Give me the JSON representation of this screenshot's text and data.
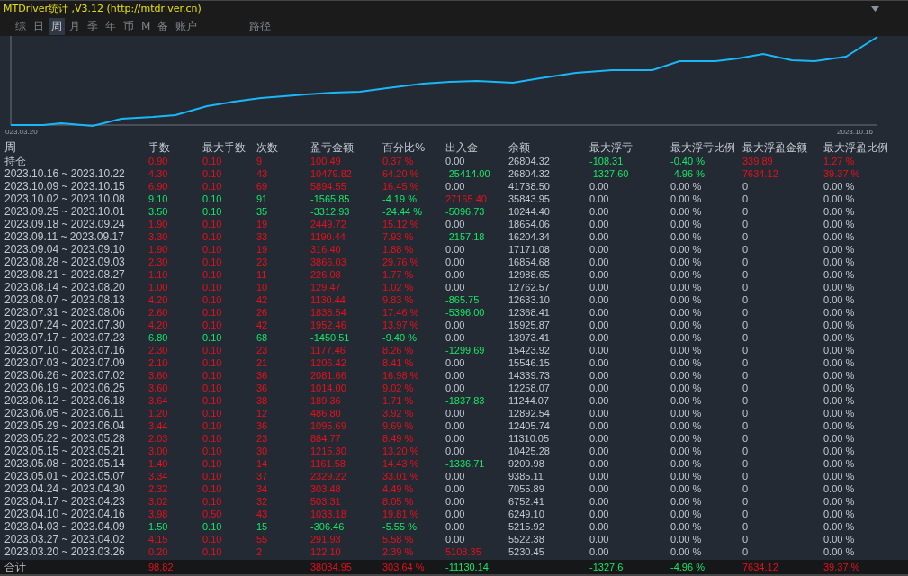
{
  "window": {
    "title": "MTDriver统计 ,V3.12 (http://mtdriver.cn)"
  },
  "tabs": [
    {
      "label": "综",
      "selected": false
    },
    {
      "label": "日",
      "selected": false
    },
    {
      "label": "周",
      "selected": true
    },
    {
      "label": "月",
      "selected": false
    },
    {
      "label": "季",
      "selected": false
    },
    {
      "label": "年",
      "selected": false
    },
    {
      "label": "币",
      "selected": false
    },
    {
      "label": "M",
      "selected": false
    },
    {
      "label": "备",
      "selected": false
    },
    {
      "label": "账户",
      "selected": false
    },
    {
      "label": "路径",
      "selected": false
    }
  ],
  "chart": {
    "start_label": "023.03.20",
    "end_label": "2023.10.16"
  },
  "table": {
    "columns": [
      "周",
      "手数",
      "最大手数",
      "次数",
      "盈亏金额",
      "百分比%",
      "出入金",
      "余额",
      "最大浮亏",
      "最大浮亏比例",
      "最大浮盈金额",
      "最大浮盈比例"
    ],
    "rows": [
      {
        "cells": [
          "持仓",
          "0.90",
          "0.10",
          "9",
          "100.49",
          "0.37 %",
          "0.00",
          "26804.32",
          "-108.31",
          "-0.40 %",
          "339.89",
          "1.27 %"
        ],
        "loss": false,
        "withdrawn": false,
        "deposited": false,
        "floating": true
      },
      {
        "cells": [
          "2023.10.16 ~ 2023.10.22",
          "4.30",
          "0.10",
          "43",
          "10479.82",
          "64.20 %",
          "-25414.00",
          "26804.32",
          "-1327.60",
          "-4.96 %",
          "7634.12",
          "39.37 %"
        ],
        "loss": false,
        "withdrawn": true,
        "deposited": false,
        "floating": true
      },
      {
        "cells": [
          "2023.10.09 ~ 2023.10.15",
          "6.90",
          "0.10",
          "69",
          "5894.55",
          "16.45 %",
          "0.00",
          "41738.50",
          "0.00",
          "0.00 %",
          "0",
          "0.00 %"
        ],
        "loss": false,
        "withdrawn": false,
        "deposited": false,
        "floating": false
      },
      {
        "cells": [
          "2023.10.02 ~ 2023.10.08",
          "9.10",
          "0.10",
          "91",
          "-1565.85",
          "-4.19 %",
          "27165.40",
          "35843.95",
          "0.00",
          "0.00 %",
          "0",
          "0.00 %"
        ],
        "loss": true,
        "withdrawn": false,
        "deposited": true,
        "floating": false
      },
      {
        "cells": [
          "2023.09.25 ~ 2023.10.01",
          "3.50",
          "0.10",
          "35",
          "-3312.93",
          "-24.44 %",
          "-5096.73",
          "10244.40",
          "0.00",
          "0.00 %",
          "0",
          "0.00 %"
        ],
        "loss": true,
        "withdrawn": true,
        "deposited": false,
        "floating": false
      },
      {
        "cells": [
          "2023.09.18 ~ 2023.09.24",
          "1.90",
          "0.10",
          "19",
          "2449.72",
          "15.12 %",
          "0.00",
          "18654.06",
          "0.00",
          "0.00 %",
          "0",
          "0.00 %"
        ],
        "loss": false,
        "withdrawn": false,
        "deposited": false,
        "floating": false
      },
      {
        "cells": [
          "2023.09.11 ~ 2023.09.17",
          "3.30",
          "0.10",
          "33",
          "1190.44",
          "7.93 %",
          "-2157.18",
          "16204.34",
          "0.00",
          "0.00 %",
          "0",
          "0.00 %"
        ],
        "loss": false,
        "withdrawn": true,
        "deposited": false,
        "floating": false
      },
      {
        "cells": [
          "2023.09.04 ~ 2023.09.10",
          "1.90",
          "0.10",
          "19",
          "316.40",
          "1.88 %",
          "0.00",
          "17171.08",
          "0.00",
          "0.00 %",
          "0",
          "0.00 %"
        ],
        "loss": false,
        "withdrawn": false,
        "deposited": false,
        "floating": false
      },
      {
        "cells": [
          "2023.08.28 ~ 2023.09.03",
          "2.30",
          "0.10",
          "23",
          "3866.03",
          "29.76 %",
          "0.00",
          "16854.68",
          "0.00",
          "0.00 %",
          "0",
          "0.00 %"
        ],
        "loss": false,
        "withdrawn": false,
        "deposited": false,
        "floating": false
      },
      {
        "cells": [
          "2023.08.21 ~ 2023.08.27",
          "1.10",
          "0.10",
          "11",
          "226.08",
          "1.77 %",
          "0.00",
          "12988.65",
          "0.00",
          "0.00 %",
          "0",
          "0.00 %"
        ],
        "loss": false,
        "withdrawn": false,
        "deposited": false,
        "floating": false
      },
      {
        "cells": [
          "2023.08.14 ~ 2023.08.20",
          "1.00",
          "0.10",
          "10",
          "129.47",
          "1.02 %",
          "0.00",
          "12762.57",
          "0.00",
          "0.00 %",
          "0",
          "0.00 %"
        ],
        "loss": false,
        "withdrawn": false,
        "deposited": false,
        "floating": false
      },
      {
        "cells": [
          "2023.08.07 ~ 2023.08.13",
          "4.20",
          "0.10",
          "42",
          "1130.44",
          "9.83 %",
          "-865.75",
          "12633.10",
          "0.00",
          "0.00 %",
          "0",
          "0.00 %"
        ],
        "loss": false,
        "withdrawn": true,
        "deposited": false,
        "floating": false
      },
      {
        "cells": [
          "2023.07.31 ~ 2023.08.06",
          "2.60",
          "0.10",
          "26",
          "1838.54",
          "17.46 %",
          "-5396.00",
          "12368.41",
          "0.00",
          "0.00 %",
          "0",
          "0.00 %"
        ],
        "loss": false,
        "withdrawn": true,
        "deposited": false,
        "floating": false
      },
      {
        "cells": [
          "2023.07.24 ~ 2023.07.30",
          "4.20",
          "0.10",
          "42",
          "1952.46",
          "13.97 %",
          "0.00",
          "15925.87",
          "0.00",
          "0.00 %",
          "0",
          "0.00 %"
        ],
        "loss": false,
        "withdrawn": false,
        "deposited": false,
        "floating": false
      },
      {
        "cells": [
          "2023.07.17 ~ 2023.07.23",
          "6.80",
          "0.10",
          "68",
          "-1450.51",
          "-9.40 %",
          "0.00",
          "13973.41",
          "0.00",
          "0.00 %",
          "0",
          "0.00 %"
        ],
        "loss": true,
        "withdrawn": false,
        "deposited": false,
        "floating": false
      },
      {
        "cells": [
          "2023.07.10 ~ 2023.07.16",
          "2.30",
          "0.10",
          "23",
          "1177.46",
          "8.26 %",
          "-1299.69",
          "15423.92",
          "0.00",
          "0.00 %",
          "0",
          "0.00 %"
        ],
        "loss": false,
        "withdrawn": true,
        "deposited": false,
        "floating": false
      },
      {
        "cells": [
          "2023.07.03 ~ 2023.07.09",
          "2.10",
          "0.10",
          "21",
          "1206.42",
          "8.41 %",
          "0.00",
          "15546.15",
          "0.00",
          "0.00 %",
          "0",
          "0.00 %"
        ],
        "loss": false,
        "withdrawn": false,
        "deposited": false,
        "floating": false
      },
      {
        "cells": [
          "2023.06.26 ~ 2023.07.02",
          "3.60",
          "0.10",
          "36",
          "2081.66",
          "16.98 %",
          "0.00",
          "14339.73",
          "0.00",
          "0.00 %",
          "0",
          "0.00 %"
        ],
        "loss": false,
        "withdrawn": false,
        "deposited": false,
        "floating": false
      },
      {
        "cells": [
          "2023.06.19 ~ 2023.06.25",
          "3.60",
          "0.10",
          "36",
          "1014.00",
          "9.02 %",
          "0.00",
          "12258.07",
          "0.00",
          "0.00 %",
          "0",
          "0.00 %"
        ],
        "loss": false,
        "withdrawn": false,
        "deposited": false,
        "floating": false
      },
      {
        "cells": [
          "2023.06.12 ~ 2023.06.18",
          "3.64",
          "0.10",
          "38",
          "189.36",
          "1.71 %",
          "-1837.83",
          "11244.07",
          "0.00",
          "0.00 %",
          "0",
          "0.00 %"
        ],
        "loss": false,
        "withdrawn": true,
        "deposited": false,
        "floating": false
      },
      {
        "cells": [
          "2023.06.05 ~ 2023.06.11",
          "1.20",
          "0.10",
          "12",
          "486.80",
          "3.92 %",
          "0.00",
          "12892.54",
          "0.00",
          "0.00 %",
          "0",
          "0.00 %"
        ],
        "loss": false,
        "withdrawn": false,
        "deposited": false,
        "floating": false
      },
      {
        "cells": [
          "2023.05.29 ~ 2023.06.04",
          "3.44",
          "0.10",
          "36",
          "1095.69",
          "9.69 %",
          "0.00",
          "12405.74",
          "0.00",
          "0.00 %",
          "0",
          "0.00 %"
        ],
        "loss": false,
        "withdrawn": false,
        "deposited": false,
        "floating": false
      },
      {
        "cells": [
          "2023.05.22 ~ 2023.05.28",
          "2.03",
          "0.10",
          "23",
          "884.77",
          "8.49 %",
          "0.00",
          "11310.05",
          "0.00",
          "0.00 %",
          "0",
          "0.00 %"
        ],
        "loss": false,
        "withdrawn": false,
        "deposited": false,
        "floating": false
      },
      {
        "cells": [
          "2023.05.15 ~ 2023.05.21",
          "3.00",
          "0.10",
          "30",
          "1215.30",
          "13.20 %",
          "0.00",
          "10425.28",
          "0.00",
          "0.00 %",
          "0",
          "0.00 %"
        ],
        "loss": false,
        "withdrawn": false,
        "deposited": false,
        "floating": false
      },
      {
        "cells": [
          "2023.05.08 ~ 2023.05.14",
          "1.40",
          "0.10",
          "14",
          "1161.58",
          "14.43 %",
          "-1336.71",
          "9209.98",
          "0.00",
          "0.00 %",
          "0",
          "0.00 %"
        ],
        "loss": false,
        "withdrawn": true,
        "deposited": false,
        "floating": false
      },
      {
        "cells": [
          "2023.05.01 ~ 2023.05.07",
          "3.34",
          "0.10",
          "37",
          "2329.22",
          "33.01 %",
          "0.00",
          "9385.11",
          "0.00",
          "0.00 %",
          "0",
          "0.00 %"
        ],
        "loss": false,
        "withdrawn": false,
        "deposited": false,
        "floating": false
      },
      {
        "cells": [
          "2023.04.24 ~ 2023.04.30",
          "2.32",
          "0.10",
          "34",
          "303.48",
          "4.49 %",
          "0.00",
          "7055.89",
          "0.00",
          "0.00 %",
          "0",
          "0.00 %"
        ],
        "loss": false,
        "withdrawn": false,
        "deposited": false,
        "floating": false
      },
      {
        "cells": [
          "2023.04.17 ~ 2023.04.23",
          "3.02",
          "0.10",
          "32",
          "503.31",
          "8.05 %",
          "0.00",
          "6752.41",
          "0.00",
          "0.00 %",
          "0",
          "0.00 %"
        ],
        "loss": false,
        "withdrawn": false,
        "deposited": false,
        "floating": false
      },
      {
        "cells": [
          "2023.04.10 ~ 2023.04.16",
          "3.98",
          "0.50",
          "43",
          "1033.18",
          "19.81 %",
          "0.00",
          "6249.10",
          "0.00",
          "0.00 %",
          "0",
          "0.00 %"
        ],
        "loss": false,
        "withdrawn": false,
        "deposited": false,
        "floating": false
      },
      {
        "cells": [
          "2023.04.03 ~ 2023.04.09",
          "1.50",
          "0.10",
          "15",
          "-306.46",
          "-5.55 %",
          "0.00",
          "5215.92",
          "0.00",
          "0.00 %",
          "0",
          "0.00 %"
        ],
        "loss": true,
        "withdrawn": false,
        "deposited": false,
        "floating": false
      },
      {
        "cells": [
          "2023.03.27 ~ 2023.04.02",
          "4.15",
          "0.10",
          "55",
          "291.93",
          "5.58 %",
          "0.00",
          "5522.38",
          "0.00",
          "0.00 %",
          "0",
          "0.00 %"
        ],
        "loss": false,
        "withdrawn": false,
        "deposited": false,
        "floating": false
      },
      {
        "cells": [
          "2023.03.20 ~ 2023.03.26",
          "0.20",
          "0.10",
          "2",
          "122.10",
          "2.39 %",
          "5108.35",
          "5230.45",
          "0.00",
          "0.00 %",
          "0",
          "0.00 %"
        ],
        "loss": false,
        "withdrawn": false,
        "deposited": true,
        "floating": false
      }
    ],
    "totals": {
      "label": "合计",
      "lots": "98.82",
      "profit": "38034.95",
      "percent": "303.64 %",
      "deposit": "-11130.14",
      "max_drawdown": "-1327.6",
      "max_drawdown_pct": "-4.96 %",
      "max_float_profit": "7634.12",
      "max_float_profit_pct": "39.37 %"
    }
  }
}
